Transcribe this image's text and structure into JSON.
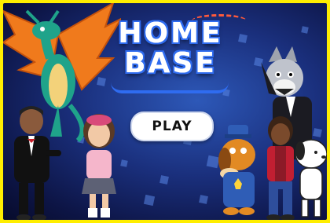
{
  "logo": {
    "line1": "HOME",
    "line2": "BASE"
  },
  "play_button": {
    "label": "PLAY"
  },
  "colors": {
    "frame": "#ffee00",
    "accent_blue": "#2f6cf0",
    "background": "#1a2f7c",
    "dragon_teal": "#1fa38a",
    "dragon_wing": "#f07a1c"
  }
}
